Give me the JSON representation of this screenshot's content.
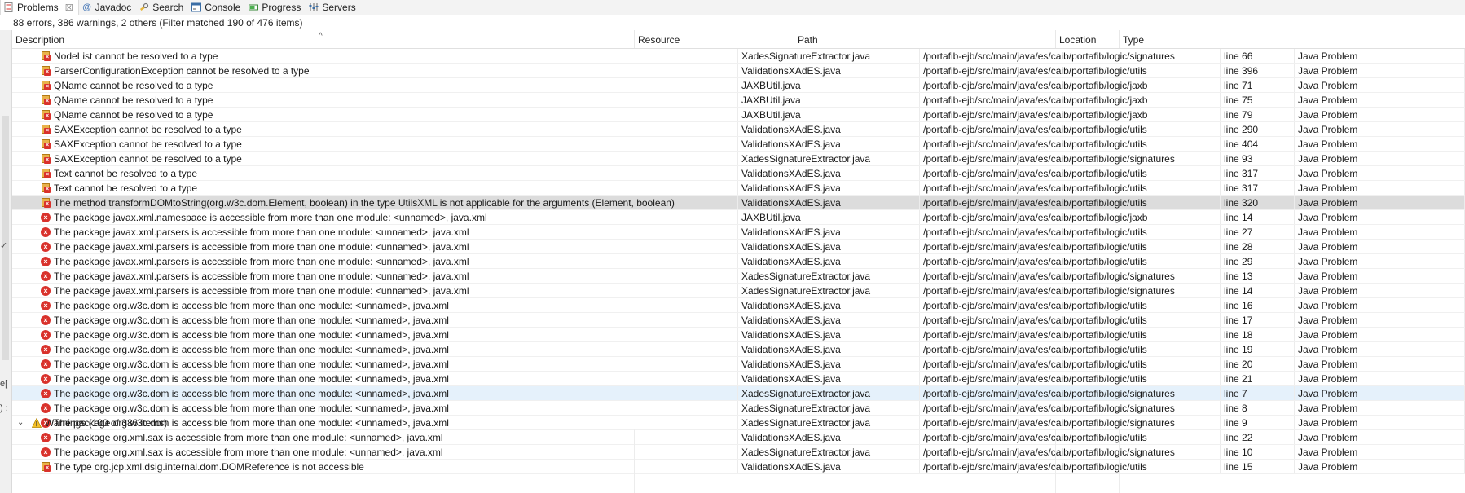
{
  "tabs": [
    {
      "label": "Problems",
      "icon": "problems-icon",
      "active": true,
      "closable": true
    },
    {
      "label": "Javadoc",
      "icon": "javadoc-icon"
    },
    {
      "label": "Search",
      "icon": "search-icon"
    },
    {
      "label": "Console",
      "icon": "console-icon"
    },
    {
      "label": "Progress",
      "icon": "progress-icon"
    },
    {
      "label": "Servers",
      "icon": "servers-icon"
    }
  ],
  "summary": "88 errors, 386 warnings, 2 others (Filter matched 190 of 476 items)",
  "columns": {
    "description": "Description",
    "resource": "Resource",
    "path": "Path",
    "location": "Location",
    "type": "Type"
  },
  "sort_indicator": "^",
  "left_marks": [
    "✓",
    "e[",
    ") :"
  ],
  "rows": [
    {
      "icon": "file-error-icon",
      "description": "NodeList cannot be resolved to a type",
      "resource": "XadesSignatureExtractor.java",
      "path": "/portafib-ejb/src/main/java/es/caib/portafib/logic/signatures",
      "location": "line 66",
      "type": "Java Problem"
    },
    {
      "icon": "file-error-icon",
      "description": "ParserConfigurationException cannot be resolved to a type",
      "resource": "ValidationsXAdES.java",
      "path": "/portafib-ejb/src/main/java/es/caib/portafib/logic/utils",
      "location": "line 396",
      "type": "Java Problem"
    },
    {
      "icon": "file-error-icon",
      "description": "QName cannot be resolved to a type",
      "resource": "JAXBUtil.java",
      "path": "/portafib-ejb/src/main/java/es/caib/portafib/logic/jaxb",
      "location": "line 71",
      "type": "Java Problem"
    },
    {
      "icon": "file-error-icon",
      "description": "QName cannot be resolved to a type",
      "resource": "JAXBUtil.java",
      "path": "/portafib-ejb/src/main/java/es/caib/portafib/logic/jaxb",
      "location": "line 75",
      "type": "Java Problem"
    },
    {
      "icon": "file-error-icon",
      "description": "QName cannot be resolved to a type",
      "resource": "JAXBUtil.java",
      "path": "/portafib-ejb/src/main/java/es/caib/portafib/logic/jaxb",
      "location": "line 79",
      "type": "Java Problem"
    },
    {
      "icon": "file-error-icon",
      "description": "SAXException cannot be resolved to a type",
      "resource": "ValidationsXAdES.java",
      "path": "/portafib-ejb/src/main/java/es/caib/portafib/logic/utils",
      "location": "line 290",
      "type": "Java Problem"
    },
    {
      "icon": "file-error-icon",
      "description": "SAXException cannot be resolved to a type",
      "resource": "ValidationsXAdES.java",
      "path": "/portafib-ejb/src/main/java/es/caib/portafib/logic/utils",
      "location": "line 404",
      "type": "Java Problem"
    },
    {
      "icon": "file-error-icon",
      "description": "SAXException cannot be resolved to a type",
      "resource": "XadesSignatureExtractor.java",
      "path": "/portafib-ejb/src/main/java/es/caib/portafib/logic/signatures",
      "location": "line 93",
      "type": "Java Problem"
    },
    {
      "icon": "file-error-icon",
      "description": "Text cannot be resolved to a type",
      "resource": "ValidationsXAdES.java",
      "path": "/portafib-ejb/src/main/java/es/caib/portafib/logic/utils",
      "location": "line 317",
      "type": "Java Problem"
    },
    {
      "icon": "file-error-icon",
      "description": "Text cannot be resolved to a type",
      "resource": "ValidationsXAdES.java",
      "path": "/portafib-ejb/src/main/java/es/caib/portafib/logic/utils",
      "location": "line 317",
      "type": "Java Problem"
    },
    {
      "icon": "file-error-icon",
      "description": "The method transformDOMtoString(org.w3c.dom.Element, boolean) in the type UtilsXML is not applicable for the arguments (Element, boolean)",
      "resource": "ValidationsXAdES.java",
      "path": "/portafib-ejb/src/main/java/es/caib/portafib/logic/utils",
      "location": "line 320",
      "type": "Java Problem",
      "state": "selected"
    },
    {
      "icon": "error-icon",
      "description": "The package javax.xml.namespace is accessible from more than one module: <unnamed>, java.xml",
      "resource": "JAXBUtil.java",
      "path": "/portafib-ejb/src/main/java/es/caib/portafib/logic/jaxb",
      "location": "line 14",
      "type": "Java Problem"
    },
    {
      "icon": "error-icon",
      "description": "The package javax.xml.parsers is accessible from more than one module: <unnamed>, java.xml",
      "resource": "ValidationsXAdES.java",
      "path": "/portafib-ejb/src/main/java/es/caib/portafib/logic/utils",
      "location": "line 27",
      "type": "Java Problem"
    },
    {
      "icon": "error-icon",
      "description": "The package javax.xml.parsers is accessible from more than one module: <unnamed>, java.xml",
      "resource": "ValidationsXAdES.java",
      "path": "/portafib-ejb/src/main/java/es/caib/portafib/logic/utils",
      "location": "line 28",
      "type": "Java Problem"
    },
    {
      "icon": "error-icon",
      "description": "The package javax.xml.parsers is accessible from more than one module: <unnamed>, java.xml",
      "resource": "ValidationsXAdES.java",
      "path": "/portafib-ejb/src/main/java/es/caib/portafib/logic/utils",
      "location": "line 29",
      "type": "Java Problem"
    },
    {
      "icon": "error-icon",
      "description": "The package javax.xml.parsers is accessible from more than one module: <unnamed>, java.xml",
      "resource": "XadesSignatureExtractor.java",
      "path": "/portafib-ejb/src/main/java/es/caib/portafib/logic/signatures",
      "location": "line 13",
      "type": "Java Problem"
    },
    {
      "icon": "error-icon",
      "description": "The package javax.xml.parsers is accessible from more than one module: <unnamed>, java.xml",
      "resource": "XadesSignatureExtractor.java",
      "path": "/portafib-ejb/src/main/java/es/caib/portafib/logic/signatures",
      "location": "line 14",
      "type": "Java Problem"
    },
    {
      "icon": "error-icon",
      "description": "The package org.w3c.dom is accessible from more than one module: <unnamed>, java.xml",
      "resource": "ValidationsXAdES.java",
      "path": "/portafib-ejb/src/main/java/es/caib/portafib/logic/utils",
      "location": "line 16",
      "type": "Java Problem"
    },
    {
      "icon": "error-icon",
      "description": "The package org.w3c.dom is accessible from more than one module: <unnamed>, java.xml",
      "resource": "ValidationsXAdES.java",
      "path": "/portafib-ejb/src/main/java/es/caib/portafib/logic/utils",
      "location": "line 17",
      "type": "Java Problem"
    },
    {
      "icon": "error-icon",
      "description": "The package org.w3c.dom is accessible from more than one module: <unnamed>, java.xml",
      "resource": "ValidationsXAdES.java",
      "path": "/portafib-ejb/src/main/java/es/caib/portafib/logic/utils",
      "location": "line 18",
      "type": "Java Problem"
    },
    {
      "icon": "error-icon",
      "description": "The package org.w3c.dom is accessible from more than one module: <unnamed>, java.xml",
      "resource": "ValidationsXAdES.java",
      "path": "/portafib-ejb/src/main/java/es/caib/portafib/logic/utils",
      "location": "line 19",
      "type": "Java Problem"
    },
    {
      "icon": "error-icon",
      "description": "The package org.w3c.dom is accessible from more than one module: <unnamed>, java.xml",
      "resource": "ValidationsXAdES.java",
      "path": "/portafib-ejb/src/main/java/es/caib/portafib/logic/utils",
      "location": "line 20",
      "type": "Java Problem"
    },
    {
      "icon": "error-icon",
      "description": "The package org.w3c.dom is accessible from more than one module: <unnamed>, java.xml",
      "resource": "ValidationsXAdES.java",
      "path": "/portafib-ejb/src/main/java/es/caib/portafib/logic/utils",
      "location": "line 21",
      "type": "Java Problem"
    },
    {
      "icon": "error-icon",
      "description": "The package org.w3c.dom is accessible from more than one module: <unnamed>, java.xml",
      "resource": "XadesSignatureExtractor.java",
      "path": "/portafib-ejb/src/main/java/es/caib/portafib/logic/signatures",
      "location": "line 7",
      "type": "Java Problem",
      "state": "hover"
    },
    {
      "icon": "error-icon",
      "description": "The package org.w3c.dom is accessible from more than one module: <unnamed>, java.xml",
      "resource": "XadesSignatureExtractor.java",
      "path": "/portafib-ejb/src/main/java/es/caib/portafib/logic/signatures",
      "location": "line 8",
      "type": "Java Problem"
    },
    {
      "icon": "error-icon",
      "description": "The package org.w3c.dom is accessible from more than one module: <unnamed>, java.xml",
      "resource": "XadesSignatureExtractor.java",
      "path": "/portafib-ejb/src/main/java/es/caib/portafib/logic/signatures",
      "location": "line 9",
      "type": "Java Problem"
    },
    {
      "icon": "error-icon",
      "description": "The package org.xml.sax is accessible from more than one module: <unnamed>, java.xml",
      "resource": "ValidationsXAdES.java",
      "path": "/portafib-ejb/src/main/java/es/caib/portafib/logic/utils",
      "location": "line 22",
      "type": "Java Problem"
    },
    {
      "icon": "error-icon",
      "description": "The package org.xml.sax is accessible from more than one module: <unnamed>, java.xml",
      "resource": "XadesSignatureExtractor.java",
      "path": "/portafib-ejb/src/main/java/es/caib/portafib/logic/signatures",
      "location": "line 10",
      "type": "Java Problem"
    },
    {
      "icon": "file-error-icon",
      "description": "The type org.jcp.xml.dsig.internal.dom.DOMReference is not accessible",
      "resource": "ValidationsXAdES.java",
      "path": "/portafib-ejb/src/main/java/es/caib/portafib/logic/utils",
      "location": "line 15",
      "type": "Java Problem"
    }
  ],
  "warnings_group": {
    "label": "Warnings (100 of 386 items)",
    "icon": "warning-icon",
    "expand_icon": "chevron-down-icon"
  }
}
